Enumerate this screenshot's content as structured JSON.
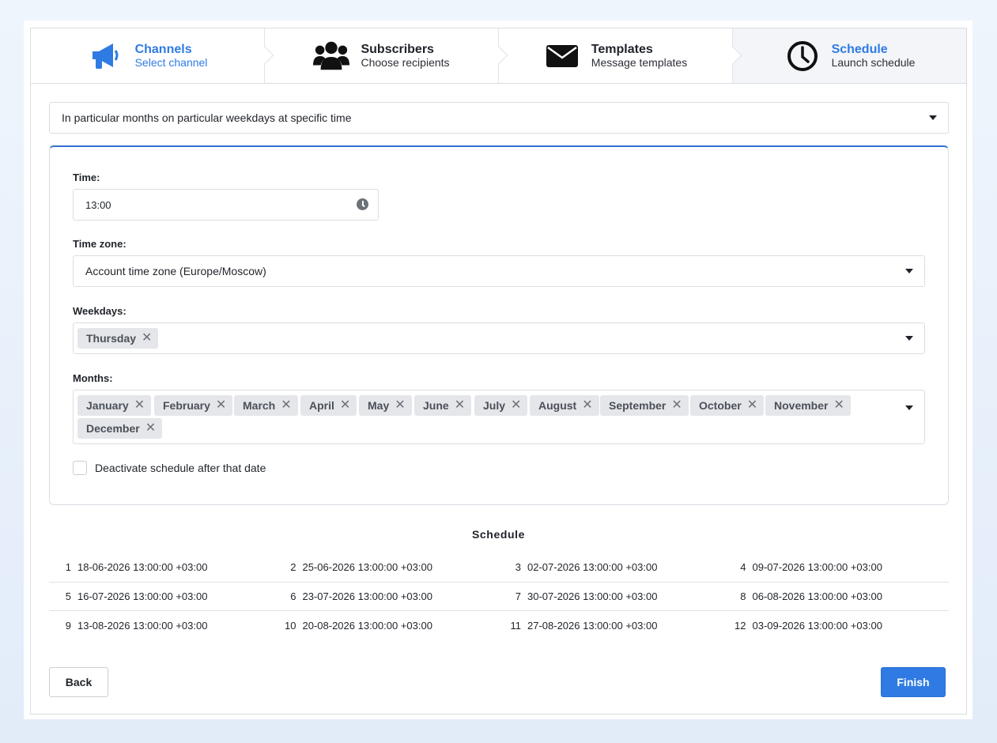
{
  "colors": {
    "accent": "#2f7be3",
    "panel_border": "#2f6fd1",
    "tag_bg": "#e4e6ea"
  },
  "steps": [
    {
      "title": "Channels",
      "subtitle": "Select channel",
      "icon": "megaphone-icon"
    },
    {
      "title": "Subscribers",
      "subtitle": "Choose recipients",
      "icon": "users-icon"
    },
    {
      "title": "Templates",
      "subtitle": "Message templates",
      "icon": "envelope-icon"
    },
    {
      "title": "Schedule",
      "subtitle": "Launch schedule",
      "icon": "clock-icon"
    }
  ],
  "schedule_mode": {
    "value": "In particular months on particular weekdays at specific time"
  },
  "form": {
    "time_label": "Time:",
    "time_value": "13:00",
    "timezone_label": "Time zone:",
    "timezone_value": "Account time zone (Europe/Moscow)",
    "weekdays_label": "Weekdays:",
    "weekdays": [
      "Thursday"
    ],
    "months_label": "Months:",
    "months": [
      "January",
      "February",
      "March",
      "April",
      "May",
      "June",
      "July",
      "August",
      "September",
      "October",
      "November",
      "December"
    ],
    "deactivate_label": "Deactivate schedule after that date",
    "deactivate_checked": false
  },
  "schedule": {
    "title": "Schedule",
    "entries": [
      {
        "n": "1",
        "date": "18-06-2026 13:00:00 +03:00"
      },
      {
        "n": "2",
        "date": "25-06-2026 13:00:00 +03:00"
      },
      {
        "n": "3",
        "date": "02-07-2026 13:00:00 +03:00"
      },
      {
        "n": "4",
        "date": "09-07-2026 13:00:00 +03:00"
      },
      {
        "n": "5",
        "date": "16-07-2026 13:00:00 +03:00"
      },
      {
        "n": "6",
        "date": "23-07-2026 13:00:00 +03:00"
      },
      {
        "n": "7",
        "date": "30-07-2026 13:00:00 +03:00"
      },
      {
        "n": "8",
        "date": "06-08-2026 13:00:00 +03:00"
      },
      {
        "n": "9",
        "date": "13-08-2026 13:00:00 +03:00"
      },
      {
        "n": "10",
        "date": "20-08-2026 13:00:00 +03:00"
      },
      {
        "n": "11",
        "date": "27-08-2026 13:00:00 +03:00"
      },
      {
        "n": "12",
        "date": "03-09-2026 13:00:00 +03:00"
      }
    ]
  },
  "buttons": {
    "back": "Back",
    "finish": "Finish"
  }
}
